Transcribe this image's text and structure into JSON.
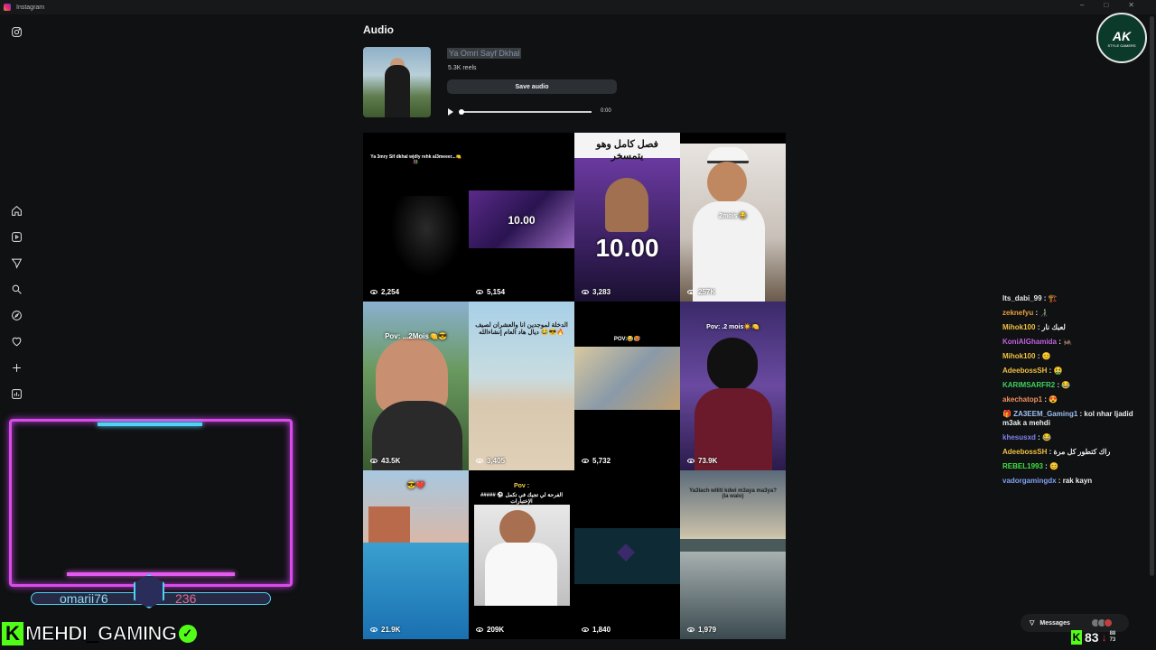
{
  "window": {
    "title": "Instagram",
    "controls": [
      "–",
      "□",
      "✕"
    ]
  },
  "sidebar": {
    "icons": [
      "instagram-icon",
      "home-icon",
      "reels-icon",
      "send-icon",
      "search-icon",
      "explore-icon",
      "heart-icon",
      "create-icon",
      "dashboard-icon"
    ]
  },
  "audio": {
    "heading": "Audio",
    "song_name": "Ya Omri Sayf Dkhal",
    "reels_count": "5.3K reels",
    "save_label": "Save audio",
    "time": "0:00"
  },
  "reels": [
    {
      "views": "2,254",
      "caption": "Ya 3mry Sif dkhal wjdly rehk al3meeer...🍋👫",
      "scene": "dark"
    },
    {
      "views": "5,154",
      "caption": "10.00",
      "scene": "purple-room"
    },
    {
      "views": "3,283",
      "caption": "فصل كامل وهو يتمسخر",
      "caption2": "10.00",
      "scene": "purple-face"
    },
    {
      "views": "257K",
      "caption": "2mois 😂",
      "scene": "rapper"
    },
    {
      "views": "43.5K",
      "caption": "Pov: ...2Mois🍋😎",
      "scene": "palms"
    },
    {
      "views": "3,405",
      "caption": "الدخلة لموجدين انا والعشران لصيف ديال هاد العام إنشاءالله 😂😎🔥",
      "scene": "beach"
    },
    {
      "views": "5,732",
      "caption": "POV:😂🥵",
      "scene": "room"
    },
    {
      "views": "73.9K",
      "caption": "Pov: .2 mois☀️🍋",
      "scene": "mask"
    },
    {
      "views": "21.9K",
      "caption": "😎❤️",
      "scene": "pool"
    },
    {
      "views": "209K",
      "caption": "Pov :",
      "caption2": "##### ⚽ الفرحة لي تجيك في تكمل الإختبارات",
      "scene": "jersey"
    },
    {
      "views": "1,840",
      "caption": "",
      "scene": "teal"
    },
    {
      "views": "1,979",
      "caption": "Ya3lach wlliti kdwi m3aya ma3ya? (la walo)",
      "scene": "sea"
    }
  ],
  "chat": [
    {
      "user": "Its_dabi_99",
      "color": "#e8e8e8",
      "msg": "🏗️"
    },
    {
      "user": "zeknefyu",
      "color": "#e8a040",
      "msg": "👨‍🦯"
    },
    {
      "user": "Mihok100",
      "color": "#f0c040",
      "msg": "لعبك نار"
    },
    {
      "user": "KoniAlGhamida",
      "color": "#c060e0",
      "msg": "🦗"
    },
    {
      "user": "Mihok100",
      "color": "#f0c040",
      "msg": "😊"
    },
    {
      "user": "AdeebossSH",
      "color": "#f0c040",
      "msg": "🤮"
    },
    {
      "user": "KARIMSARFR2",
      "color": "#40d060",
      "msg": "😂"
    },
    {
      "user": "akechatop1",
      "color": "#f09060",
      "msg": "😍"
    },
    {
      "user": "🎁 ZA3EEM_Gaming1",
      "color": "#a0c0f0",
      "msg": "kol nhar ljadid m3ak a mehdi"
    },
    {
      "user": "khesusxd",
      "color": "#8080f0",
      "msg": "😂"
    },
    {
      "user": "AdeebossSH",
      "color": "#f0c040",
      "msg": "راك كتطور كل مرة"
    },
    {
      "user": "REBEL1993",
      "color": "#40e040",
      "msg": "😊"
    },
    {
      "user": "vadorgamingdx",
      "color": "#80a0f0",
      "msg": "rak kayn"
    }
  ],
  "messages_label": "Messages",
  "overlay": {
    "streamer": "omarii76",
    "streamer_num": "236",
    "brand_name": "MEHDI_GAMING",
    "brand_letter": "K",
    "check": "✓",
    "logo_main": "AK",
    "logo_sub": "STYLE GAMERS",
    "viewers": "83",
    "stat_a": "88",
    "stat_b": "73"
  }
}
